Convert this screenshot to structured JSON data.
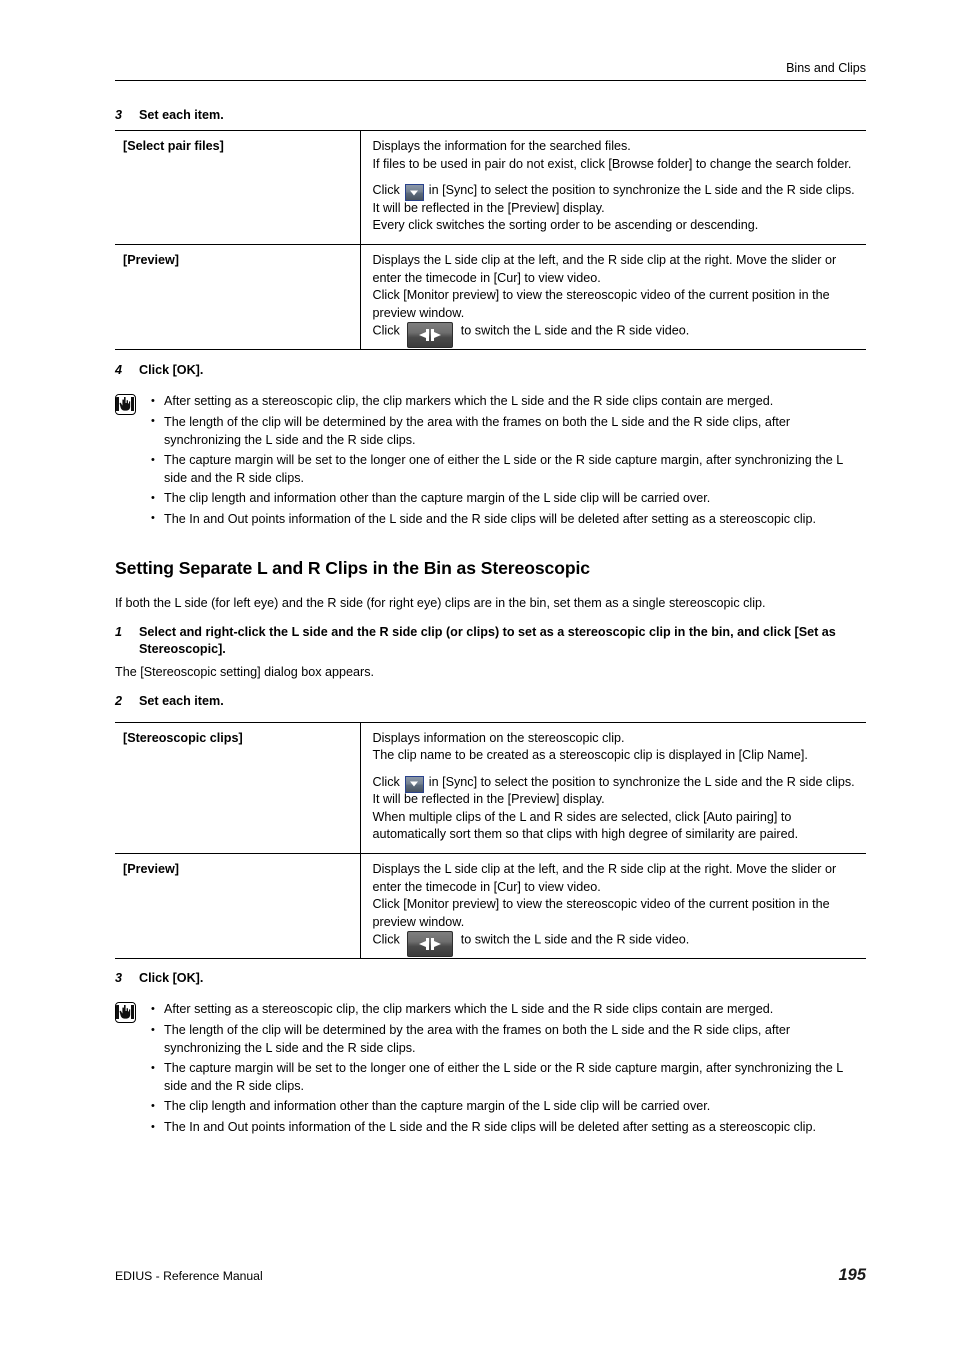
{
  "header": {
    "running_title": "Bins and Clips"
  },
  "footer": {
    "manual_name": "EDIUS - Reference Manual",
    "page_number": "195"
  },
  "icons": {
    "dropdown": "dropdown-arrow-icon",
    "switch": "switch-lr-icon",
    "note": "note-hand-icon"
  },
  "steps_top": {
    "step3": {
      "num": "3",
      "text": "Set each item."
    },
    "step4": {
      "num": "4",
      "text": "Click [OK]."
    }
  },
  "table1": {
    "rows": [
      {
        "term": "[Select pair files]",
        "lines": [
          "Displays the information for the searched files.",
          "If files to be used in pair do not exist, click [Browse folder] to change the search folder."
        ],
        "click_sync_prefix": "Click",
        "click_sync_suffix": "in [Sync] to select the position to synchronize the L side and the R side clips. It will be reflected in the [Preview] display.",
        "trailing": "Every click switches the sorting order to be ascending or descending."
      },
      {
        "term": "[Preview]",
        "lines": [
          "Displays the L side clip at the left, and the R side clip at the right. Move the slider or enter the timecode in [Cur] to view video.",
          "Click [Monitor preview] to view the stereoscopic video of the current position in the preview window."
        ],
        "click_switch_prefix": "Click",
        "click_switch_suffix": "to switch the L side and the R side video."
      }
    ]
  },
  "notes1": [
    "After setting as a stereoscopic clip, the clip markers which the L side and the R side clips contain are merged.",
    "The length of the clip will be determined by the area with the frames on both the L side and the R side clips, after synchronizing the L side and the R side clips.",
    "The capture margin will be set to the longer one of either the L side or the R side capture margin, after synchronizing the L side and the R side clips.",
    "The clip length and information other than the capture margin of the L side clip will be carried over.",
    "The In and Out points information of the L side and the R side clips will be deleted after setting as a stereoscopic clip."
  ],
  "section": {
    "heading": "Setting Separate L and R Clips in the Bin as Stereoscopic",
    "intro": "If both the L side (for left eye) and the R side (for right eye) clips are in the bin, set them as a single stereoscopic clip.",
    "step1": {
      "num": "1",
      "text": "Select and right-click the L side and the R side clip (or clips) to set as a stereoscopic clip in the bin, and click [Set as Stereoscopic]."
    },
    "after_step1": "The [Stereoscopic setting] dialog box appears.",
    "step2": {
      "num": "2",
      "text": "Set each item."
    },
    "step3": {
      "num": "3",
      "text": "Click [OK]."
    }
  },
  "table2": {
    "rows": [
      {
        "term": "[Stereoscopic clips]",
        "lines": [
          "Displays information on the stereoscopic clip.",
          "The clip name to be created as a stereoscopic clip is displayed in [Clip Name]."
        ],
        "click_sync_prefix": "Click",
        "click_sync_suffix": "in [Sync] to select the position to synchronize the L side and the R side clips. It will be reflected in the [Preview] display.",
        "trailing": "When multiple clips of the L and R sides are selected, click [Auto pairing] to automatically sort them so that clips with high degree of similarity are paired."
      },
      {
        "term": "[Preview]",
        "lines": [
          "Displays the L side clip at the left, and the R side clip at the right. Move the slider or enter the timecode in [Cur] to view video.",
          "Click [Monitor preview] to view the stereoscopic video of the current position in the preview window."
        ],
        "click_switch_prefix": "Click",
        "click_switch_suffix": "to switch the L side and the R side video."
      }
    ]
  },
  "notes2": [
    "After setting as a stereoscopic clip, the clip markers which the L side and the R side clips contain are merged.",
    "The length of the clip will be determined by the area with the frames on both the L side and the R side clips, after synchronizing the L side and the R side clips.",
    "The capture margin will be set to the longer one of either the L side or the R side capture margin, after synchronizing the L side and the R side clips.",
    "The clip length and information other than the capture margin of the L side clip will be carried over.",
    "The In and Out points information of the L side and the R side clips will be deleted after setting as a stereoscopic clip."
  ]
}
